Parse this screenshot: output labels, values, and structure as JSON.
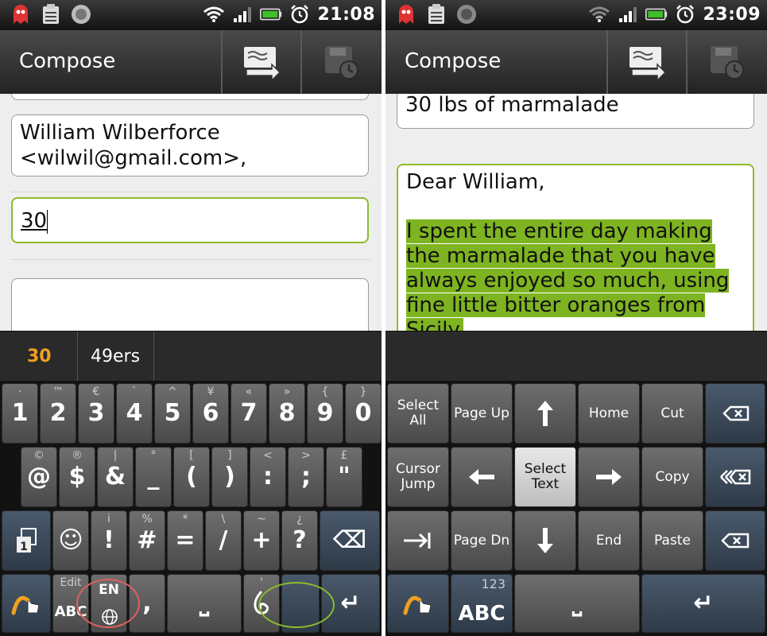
{
  "left": {
    "status": {
      "time": "21:08"
    },
    "title": "Compose",
    "to_field": "William Wilberforce <wilwil@gmail.com>,",
    "subject_field": "30",
    "suggestions": [
      "30",
      "49ers"
    ],
    "keyboard": {
      "row1": [
        [
          "·",
          "1"
        ],
        [
          "™",
          "2"
        ],
        [
          "€",
          "3"
        ],
        [
          "`",
          "4"
        ],
        [
          "^",
          "5"
        ],
        [
          "¥",
          "6"
        ],
        [
          "«",
          "7"
        ],
        [
          "»",
          "8"
        ],
        [
          "{",
          "9"
        ],
        [
          "}",
          "0"
        ]
      ],
      "row2": [
        [
          "©",
          "@"
        ],
        [
          "®",
          "$"
        ],
        [
          "|",
          "&"
        ],
        [
          "°",
          "_"
        ],
        [
          "[",
          "("
        ],
        [
          "]",
          ")"
        ],
        [
          "<",
          ":"
        ],
        [
          ">",
          ";"
        ],
        [
          "£",
          "\""
        ]
      ],
      "row3": [
        [
          "",
          "☺"
        ],
        [
          "i",
          "!"
        ],
        [
          "%",
          "#"
        ],
        [
          "*",
          "="
        ],
        [
          "\\",
          "/"
        ],
        [
          "~",
          "+"
        ],
        [
          "¿",
          "?"
        ]
      ],
      "edit_label": "Edit",
      "abc_label": "ABC",
      "lang_label": "EN",
      "comma": ",",
      "space": "⎵",
      "comma_sup": "'",
      "enter": "↵",
      "backspace": "⌫"
    },
    "annotation_colors": {
      "lang_circle": "#e06060",
      "dragon_circle": "#8dbb2c"
    }
  },
  "right": {
    "status": {
      "time": "23:09"
    },
    "title": "Compose",
    "subject_field": "30 lbs of marmalade",
    "body_greeting": "Dear William,",
    "body_selected": "I spent the entire day making the marmalade that you have always enjoyed so much, using fine little bitter oranges from Sicily.",
    "selection_color": "#7eb421",
    "keys": {
      "select_all": "Select All",
      "page_up": "Page Up",
      "home": "Home",
      "cut": "Cut",
      "cursor_jump": "Cursor Jump",
      "select_text": "Select Text",
      "copy": "Copy",
      "page_dn": "Page Dn",
      "end": "End",
      "paste": "Paste",
      "num_label": "123",
      "abc_label": "ABC",
      "space": "⎵",
      "enter": "↵"
    }
  }
}
